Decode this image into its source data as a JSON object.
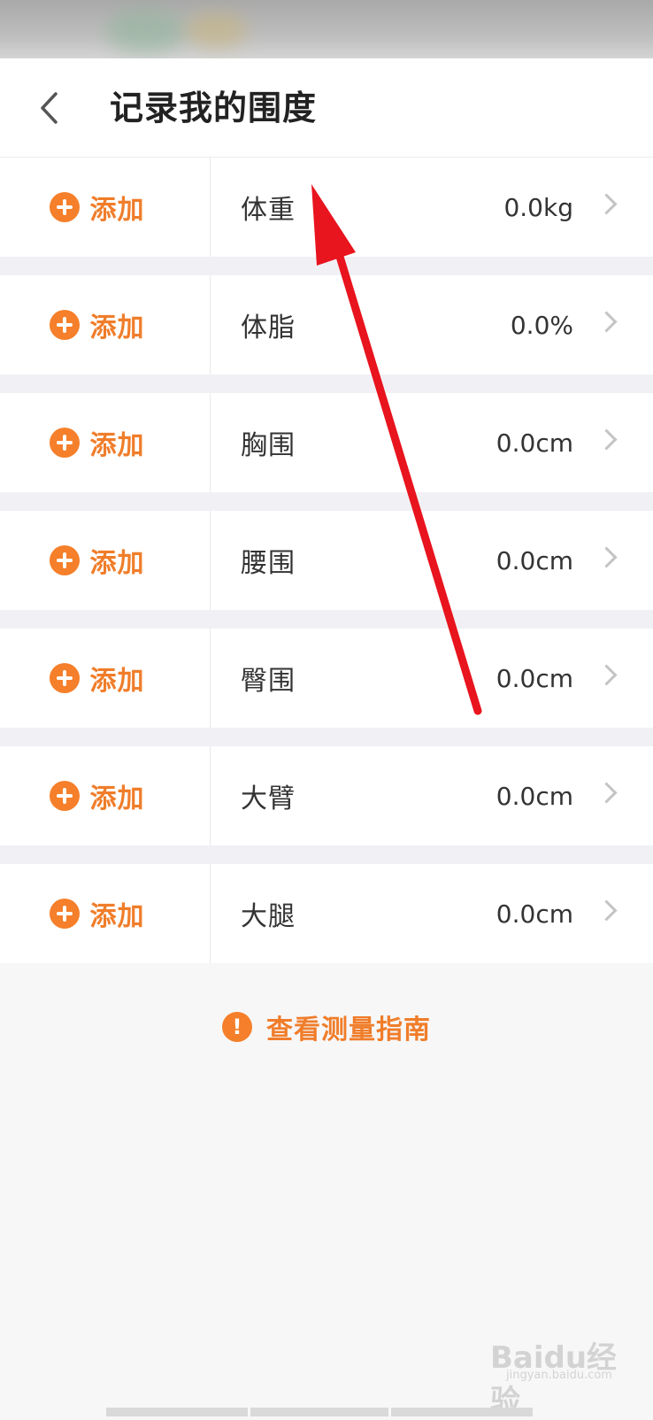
{
  "header": {
    "title": "记录我的围度"
  },
  "add_label": "添加",
  "measurements": [
    {
      "name": "体重",
      "value": "0.0kg"
    },
    {
      "name": "体脂",
      "value": "0.0%"
    },
    {
      "name": "胸围",
      "value": "0.0cm"
    },
    {
      "name": "腰围",
      "value": "0.0cm"
    },
    {
      "name": "臀围",
      "value": "0.0cm"
    },
    {
      "name": "大臂",
      "value": "0.0cm"
    },
    {
      "name": "大腿",
      "value": "0.0cm"
    }
  ],
  "guide": {
    "label": "查看测量指南"
  },
  "watermark": {
    "text": "Baidu经验",
    "sub": "jingyan.baidu.com"
  },
  "colors": {
    "accent": "#f57f2a",
    "annotation_arrow": "#e8141e",
    "divider_band": "#f1f1f5"
  },
  "icons": {
    "back": "chevron-left-icon",
    "add": "plus-circle-icon",
    "row_arrow": "chevron-right-icon",
    "guide": "exclamation-circle-icon"
  }
}
